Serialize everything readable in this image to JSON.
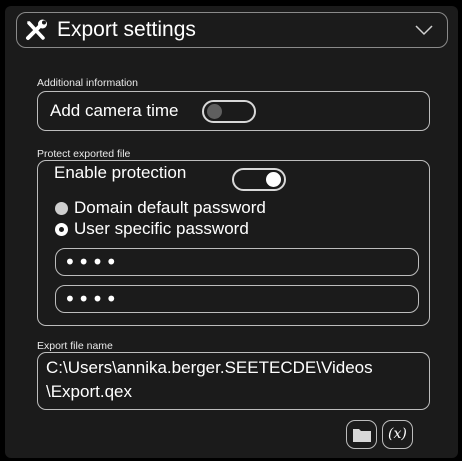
{
  "header": {
    "title": "Export settings",
    "icon": "tools-icon",
    "collapse_icon": "chevron-down-icon"
  },
  "additional_info": {
    "label": "Additional information",
    "add_camera_time_label": "Add camera time",
    "add_camera_time_on": false
  },
  "protect": {
    "label": "Protect exported file",
    "enable_label": "Enable protection",
    "enable_on": true,
    "options": [
      {
        "label": "Domain default password",
        "selected": false
      },
      {
        "label": "User specific password",
        "selected": true
      }
    ],
    "password_1": "••••",
    "password_2": "••••"
  },
  "export_name": {
    "label": "Export file name",
    "line_1": "C:\\Users\\annika.berger.SEETECDE\\Videos",
    "line_2": "\\Export.qex",
    "browse_icon": "folder-icon",
    "variables_label": "(x)"
  },
  "colors": {
    "background": "#1b1b1b",
    "border": "#bdbdbd",
    "accent": "#ffffff"
  }
}
